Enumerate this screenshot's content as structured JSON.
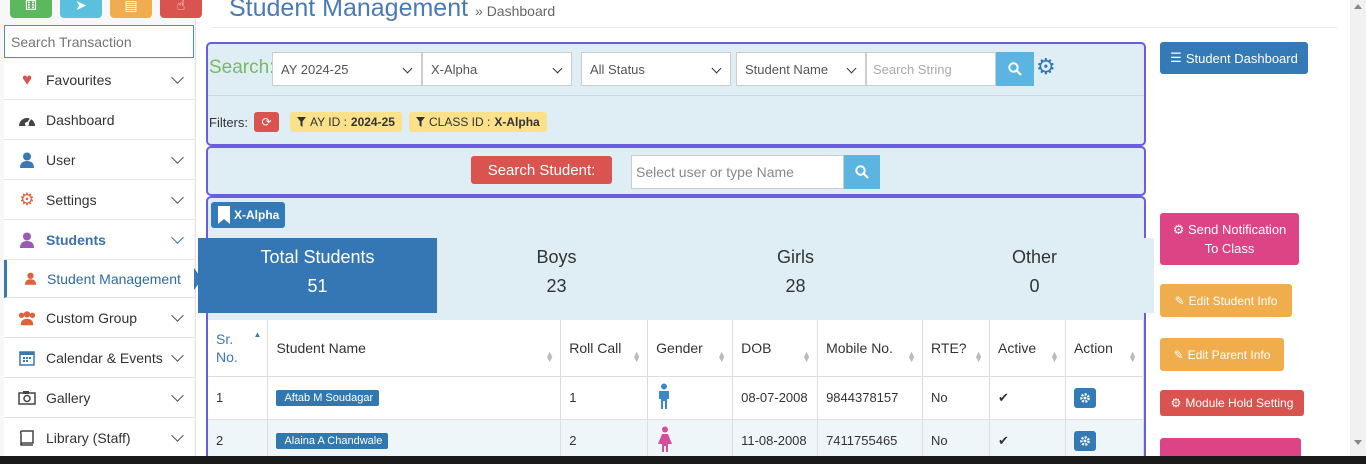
{
  "sidebar": {
    "search_placeholder": "Search Transaction",
    "items": [
      {
        "label": "Favourites"
      },
      {
        "label": "Dashboard"
      },
      {
        "label": "User"
      },
      {
        "label": "Settings"
      },
      {
        "label": "Students"
      },
      {
        "label": "Student Management"
      },
      {
        "label": "Custom Group"
      },
      {
        "label": "Calendar & Events"
      },
      {
        "label": "Gallery"
      },
      {
        "label": "Library (Staff)"
      }
    ]
  },
  "header": {
    "title": "Student Management",
    "breadcrumb": "» Dashboard"
  },
  "search": {
    "label": "Search:",
    "ay": "AY 2024-25",
    "class": "X-Alpha",
    "status": "All Status",
    "field": "Student Name",
    "string_placeholder": "Search String",
    "filters_label": "Filters:",
    "chip_ay_key": "AY ID :",
    "chip_ay_val": "2024-25",
    "chip_class_key": "CLASS ID :",
    "chip_class_val": "X-Alpha"
  },
  "student_search": {
    "button": "Search Student:",
    "placeholder": "Select user or type Name"
  },
  "class_badge": "X-Alpha",
  "stats": [
    {
      "label": "Total Students",
      "value": "51"
    },
    {
      "label": "Boys",
      "value": "23"
    },
    {
      "label": "Girls",
      "value": "28"
    },
    {
      "label": "Other",
      "value": "0"
    }
  ],
  "table": {
    "headers": [
      "Sr. No.",
      "Student Name",
      "Roll Call",
      "Gender",
      "DOB",
      "Mobile No.",
      "RTE?",
      "Active",
      "Action"
    ],
    "rows": [
      {
        "sr": "1",
        "name": "Aftab M Soudagar",
        "roll": "1",
        "gender": "male",
        "dob": "08-07-2008",
        "mobile": "9844378157",
        "rte": "No"
      },
      {
        "sr": "2",
        "name": "Alaina A Chandwale",
        "roll": "2",
        "gender": "female",
        "dob": "11-08-2008",
        "mobile": "7411755465",
        "rte": "No"
      }
    ]
  },
  "right_buttons": {
    "dashboard": "Student Dashboard",
    "notify_line1": "Send Notification",
    "notify_line2": "To Class",
    "edit_student": "Edit Student Info",
    "edit_parent": "Edit Parent Info",
    "hold": "Module Hold Setting"
  },
  "colors": {
    "primary": "#337ab7",
    "danger": "#d9534f",
    "warning": "#f0ad4e",
    "pink": "#dc4485",
    "panel_bg": "#dfeef5",
    "panel_border": "#6a5de0"
  }
}
